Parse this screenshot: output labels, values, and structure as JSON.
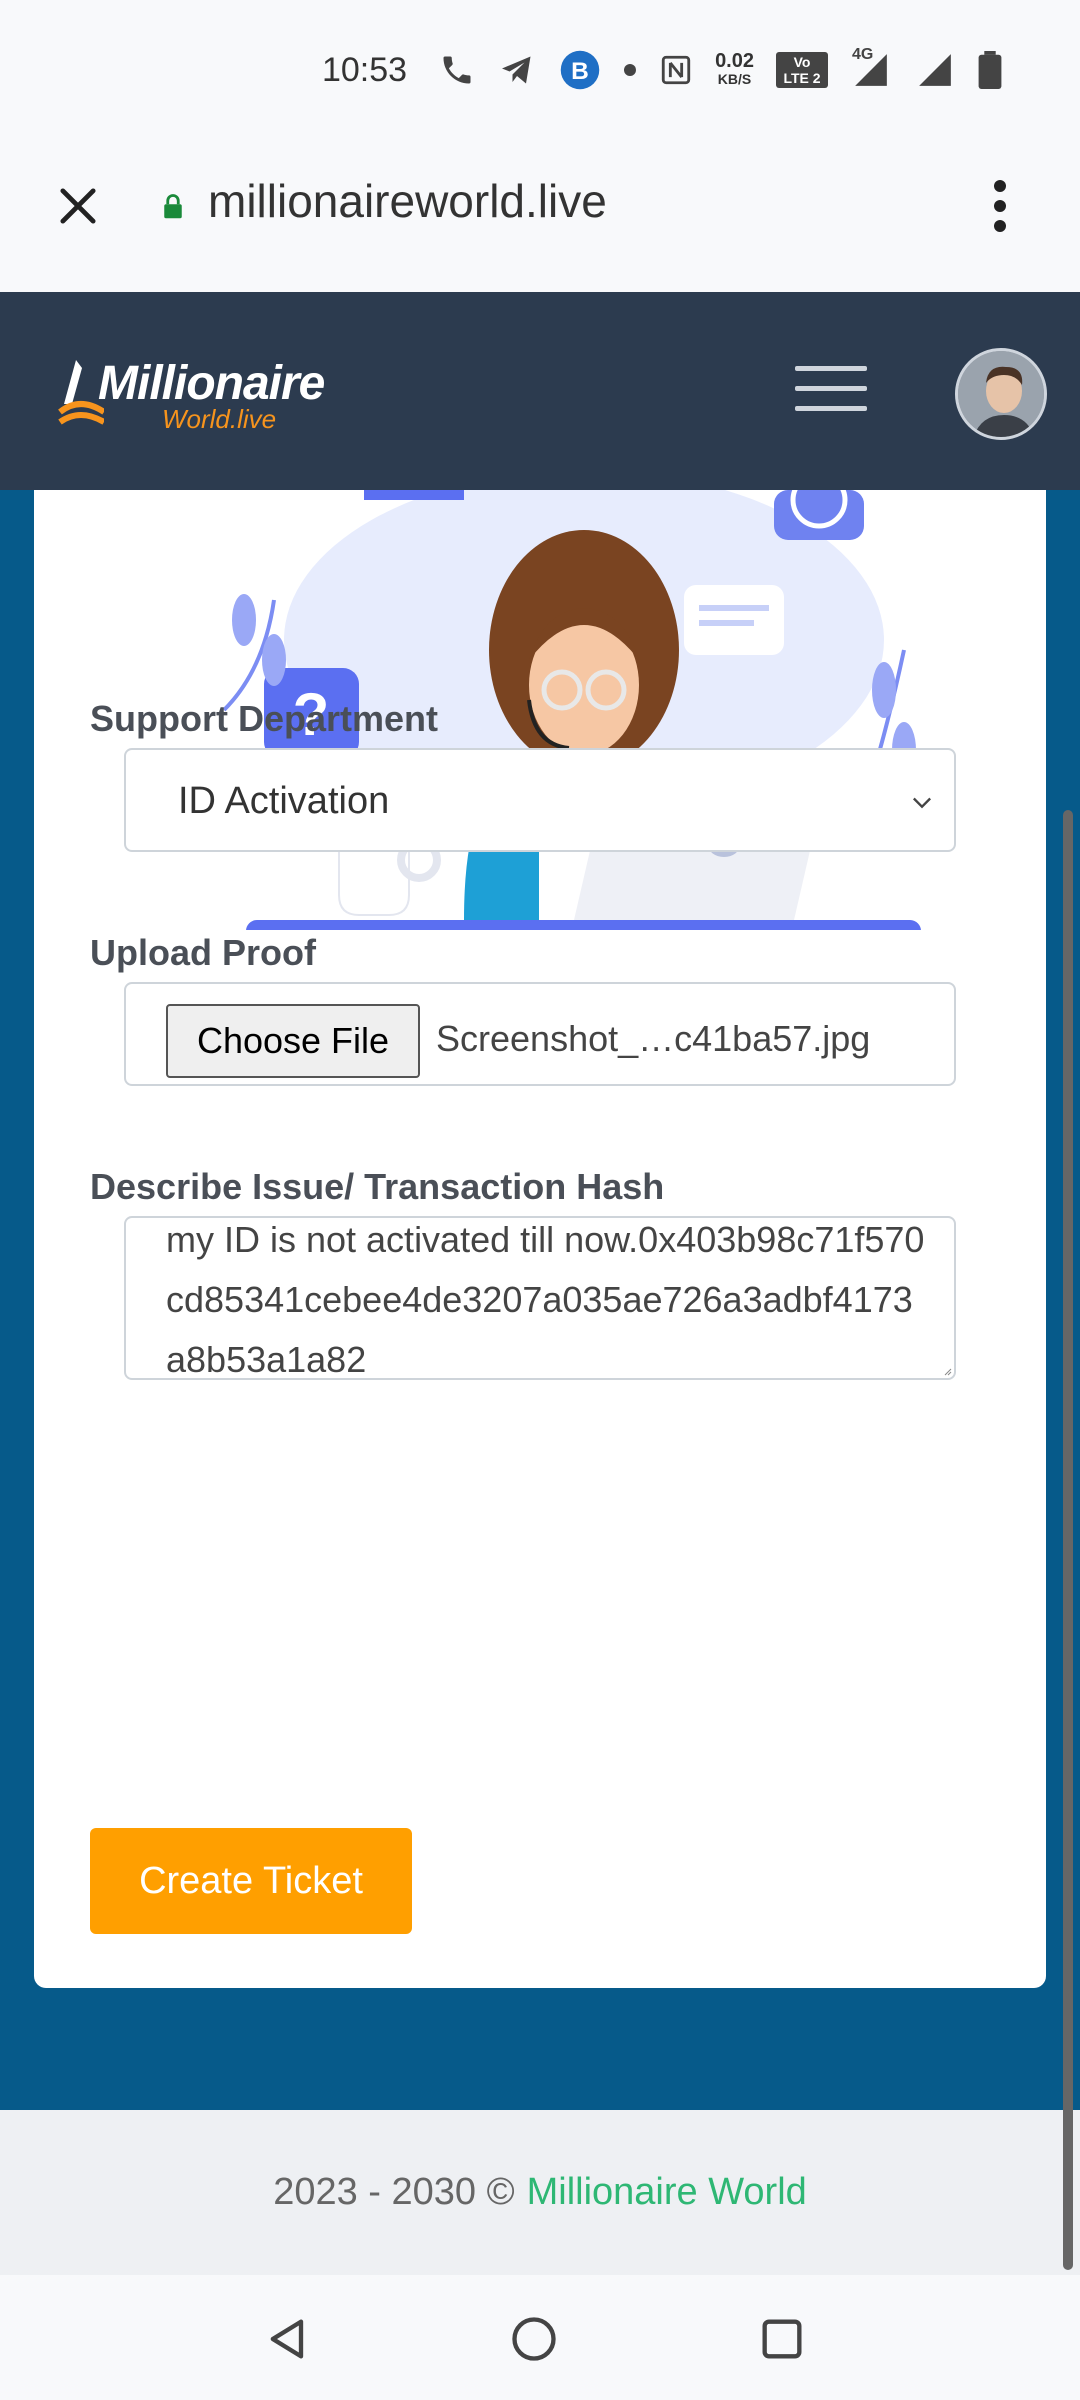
{
  "status_bar": {
    "time": "10:53",
    "speed_value": "0.02",
    "speed_unit": "KB/S",
    "volte": "Vo LTE 2",
    "network": "4G",
    "icons": [
      "phone-icon",
      "telegram-icon",
      "b-app-icon",
      "dot-icon",
      "nfc-icon",
      "signal-icon",
      "signal-icon",
      "battery-icon"
    ]
  },
  "browser": {
    "url": "millionaireworld.live"
  },
  "header": {
    "logo_main": "Millionaire",
    "logo_sub": "World.live"
  },
  "form": {
    "department_label": "Support Department",
    "department_value": "ID Activation",
    "upload_label": "Upload Proof",
    "choose_file_label": "Choose File",
    "file_name": "Screenshot_…c41ba57.jpg",
    "issue_label": "Describe Issue/ Transaction Hash",
    "issue_text": "my ID is not activated till now.0x403b98c71f570cd85341cebee4de3207a035ae726a3adbf4173a8b53a1a82",
    "submit_label": "Create Ticket"
  },
  "footer": {
    "years": "2023 - 2030 ©",
    "brand": "Millionaire World"
  },
  "colors": {
    "header_bg": "#2c3b4f",
    "main_bg": "#065a8a",
    "accent_button": "#ff9f00",
    "footer_link": "#2eb774"
  }
}
